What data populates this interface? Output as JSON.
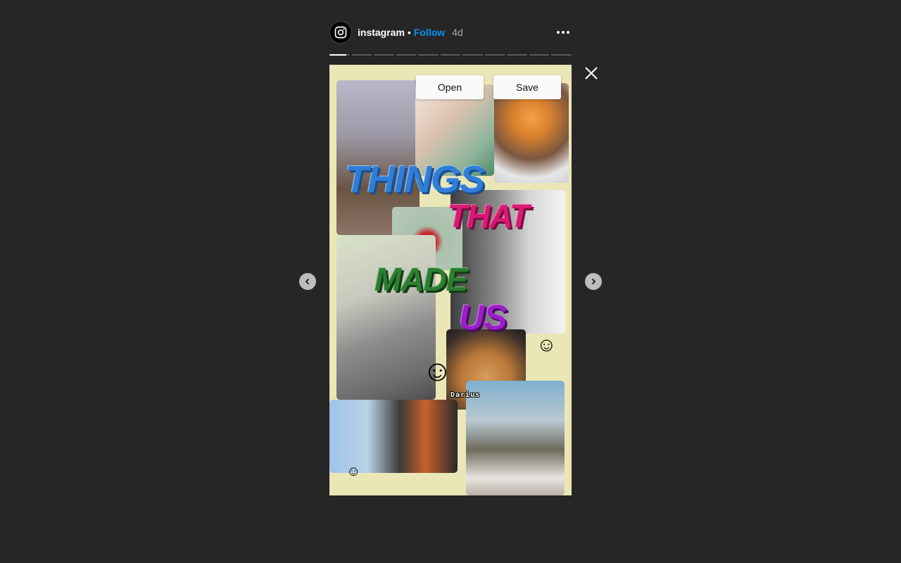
{
  "header": {
    "username": "instagram",
    "separator": "•",
    "follow_label": "Follow",
    "age": "4d",
    "avatar_icon": "instagram-logo-icon",
    "more_icon": "more-options-icon"
  },
  "progress": {
    "segments": 11,
    "active_index": 0,
    "active_progress": 0.85
  },
  "story": {
    "words": [
      "THINGS",
      "THAT",
      "MADE",
      "US"
    ],
    "caption": "Darius",
    "emoji": [
      "☺",
      "☺",
      "☺"
    ]
  },
  "overlay_buttons": {
    "open_label": "Open",
    "save_label": "Save"
  },
  "controls": {
    "close_icon": "close-icon",
    "prev_icon": "chevron-left-icon",
    "next_icon": "chevron-right-icon"
  },
  "colors": {
    "background": "#262626",
    "follow": "#0095f6",
    "story_background": "#ebe6b6",
    "things": "#2f7ed8",
    "that": "#d81a74",
    "made": "#2e7d32",
    "us": "#9b1fc8"
  }
}
